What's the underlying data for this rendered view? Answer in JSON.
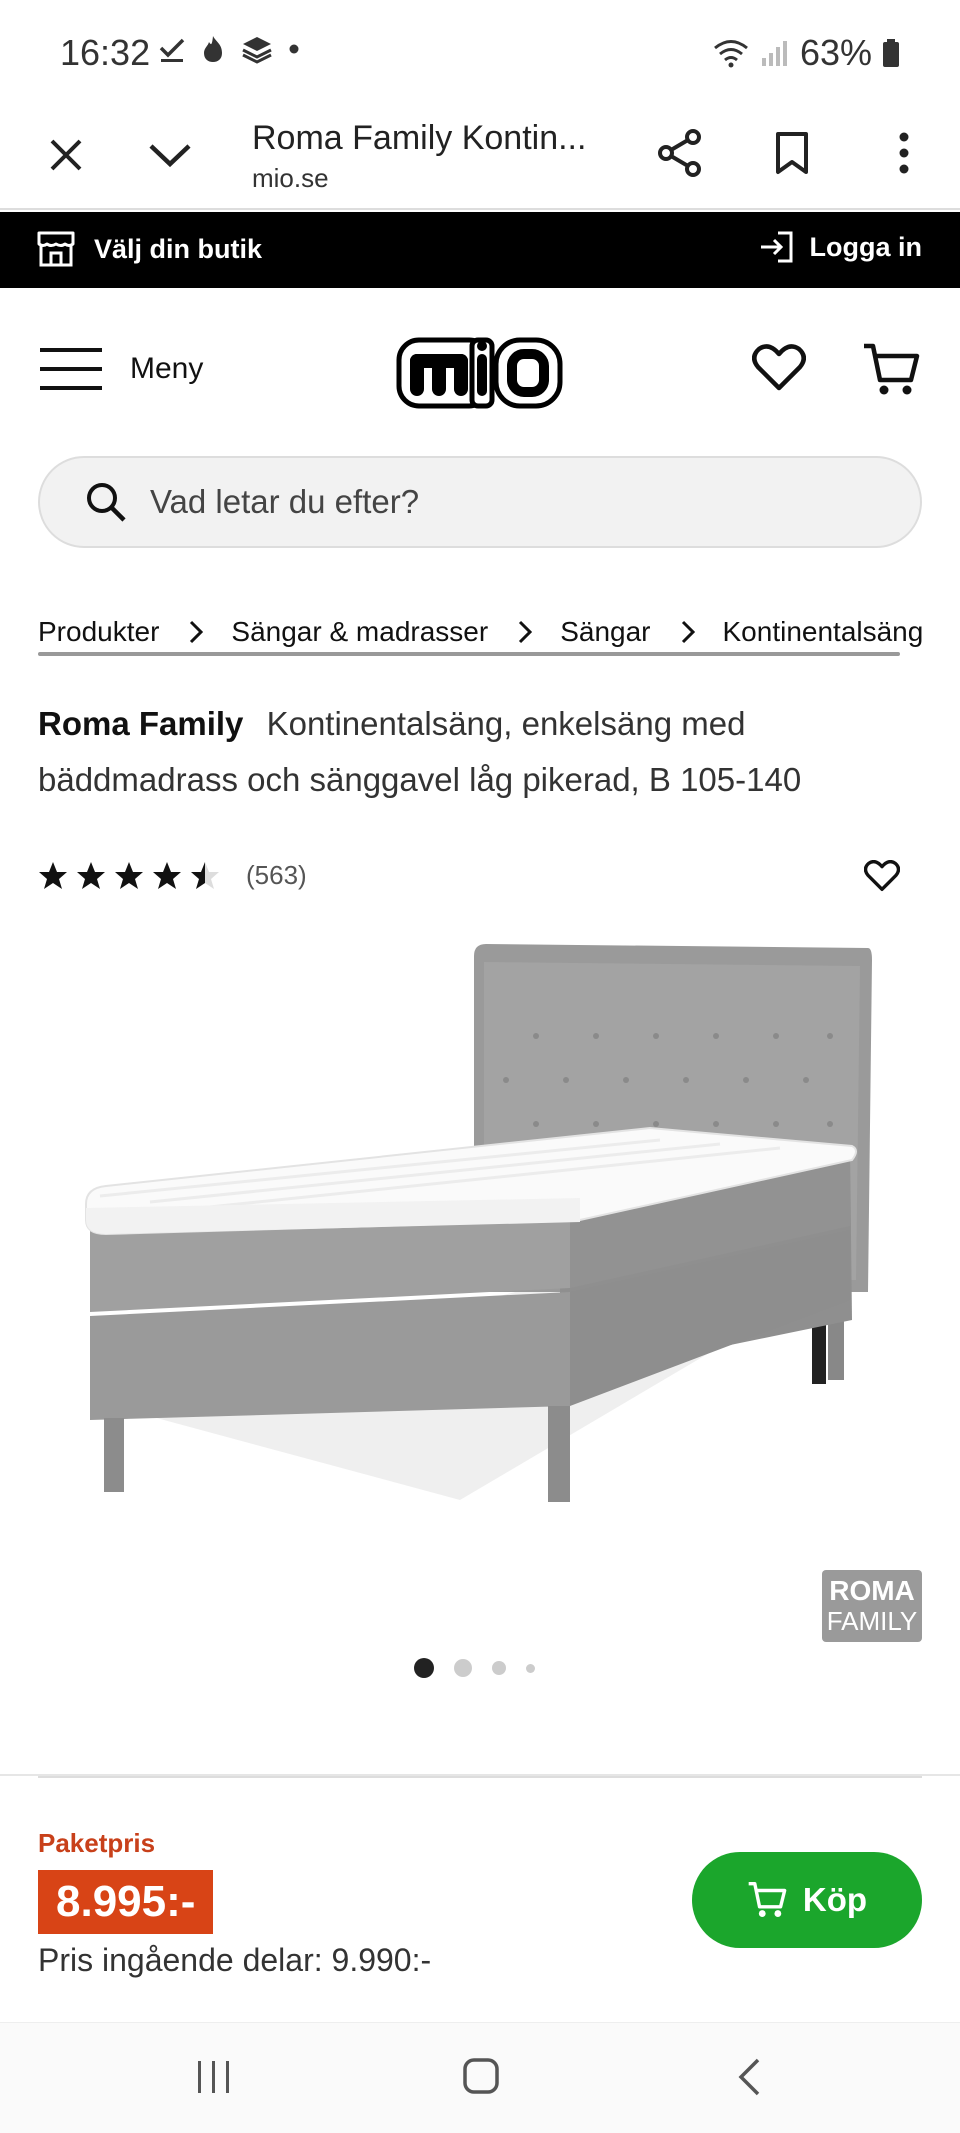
{
  "status_bar": {
    "time": "16:32",
    "battery": "63%"
  },
  "browser": {
    "title": "Roma Family Kontin...",
    "url": "mio.se"
  },
  "store_bar": {
    "choose_store": "Välj din butik",
    "login": "Logga in"
  },
  "header": {
    "menu_label": "Meny",
    "logo_text": "mio"
  },
  "search": {
    "placeholder": "Vad letar du efter?"
  },
  "breadcrumb": {
    "items": [
      "Produkter",
      "Sängar & madrasser",
      "Sängar",
      "Kontinentalsängar"
    ]
  },
  "product": {
    "brand": "Roma Family",
    "description": "Kontinentalsäng, enkelsäng med bäddmadrass och sänggavel låg pikerad, B 105-140",
    "rating_value": 4.5,
    "rating_count": "(563)",
    "badge_line1": "ROMA",
    "badge_line2": "FAMILY",
    "image_count": 4,
    "active_image": 1
  },
  "purchase": {
    "package_label": "Paketpris",
    "price": "8.995:-",
    "parts_price": "Pris ingående delar: 9.990:-",
    "buy_label": "Köp"
  },
  "colors": {
    "accent_green": "#1ba62c",
    "price_orange": "#d84416",
    "label_orange": "#c8401a",
    "store_bar_bg": "#000000"
  }
}
